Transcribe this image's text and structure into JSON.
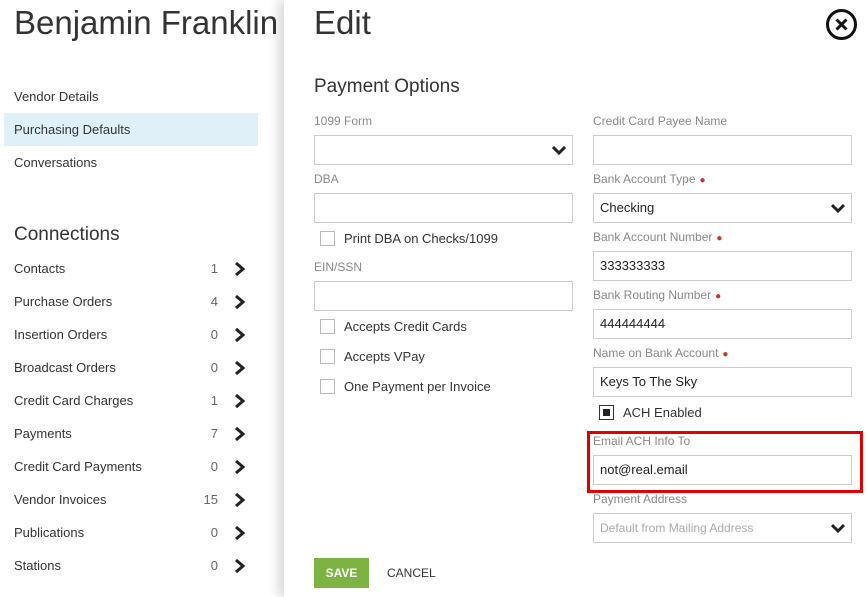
{
  "vendor": {
    "title": "Benjamin Franklin",
    "nav": [
      "Vendor Details",
      "Purchasing Defaults",
      "Conversations"
    ],
    "active_nav": "Purchasing Defaults",
    "connections_heading": "Connections",
    "connections": [
      {
        "label": "Contacts",
        "count": "1"
      },
      {
        "label": "Purchase Orders",
        "count": "4"
      },
      {
        "label": "Insertion Orders",
        "count": "0"
      },
      {
        "label": "Broadcast Orders",
        "count": "0"
      },
      {
        "label": "Credit Card Charges",
        "count": "1"
      },
      {
        "label": "Payments",
        "count": "7"
      },
      {
        "label": "Credit Card Payments",
        "count": "0"
      },
      {
        "label": "Vendor Invoices",
        "count": "15"
      },
      {
        "label": "Publications",
        "count": "0"
      },
      {
        "label": "Stations",
        "count": "0"
      }
    ]
  },
  "modal": {
    "title": "Edit",
    "section": "Payment Options",
    "left": {
      "form1099_label": "1099 Form",
      "form1099_value": "",
      "dba_label": "DBA",
      "dba_value": "",
      "print_dba_label": "Print DBA on Checks/1099",
      "ein_label": "EIN/SSN",
      "ein_value": "",
      "accepts_cc_label": "Accepts Credit Cards",
      "accepts_vpay_label": "Accepts VPay",
      "one_payment_label": "One Payment per Invoice"
    },
    "right": {
      "cc_payee_label": "Credit Card Payee Name",
      "cc_payee_value": "",
      "bank_type_label": "Bank Account Type",
      "bank_type_value": "Checking",
      "bank_number_label": "Bank Account Number",
      "bank_number_value": "333333333",
      "routing_label": "Bank Routing Number",
      "routing_value": "444444444",
      "name_on_account_label": "Name on Bank Account",
      "name_on_account_value": "Keys To The Sky",
      "ach_enabled_label": "ACH Enabled",
      "ach_enabled": true,
      "email_ach_label": "Email ACH Info To",
      "email_ach_value": "not@real.email",
      "payment_address_label": "Payment Address",
      "payment_address_placeholder": "Default from Mailing Address"
    },
    "save_label": "SAVE",
    "cancel_label": "CANCEL"
  },
  "colors": {
    "save_green": "#7cb342",
    "highlight_red": "#e00000",
    "required_dot": "#c0392b",
    "active_nav_bg": "#dff0f8"
  }
}
